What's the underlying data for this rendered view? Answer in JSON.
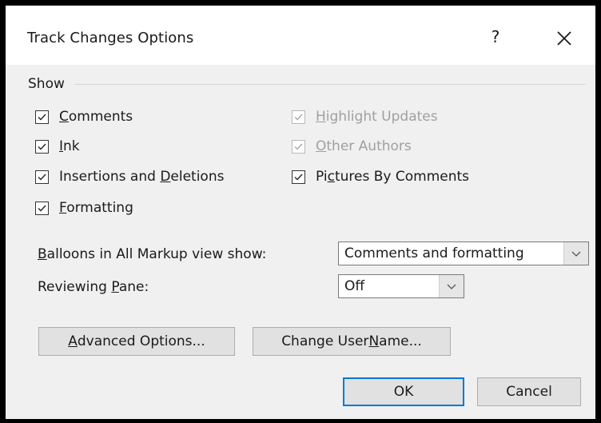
{
  "dialog": {
    "title": "Track Changes Options",
    "help_label": "?",
    "close_icon": "close-icon"
  },
  "show_group": {
    "label": "Show",
    "checkboxes": [
      {
        "pre": "",
        "key": "C",
        "post": "omments",
        "checked": true,
        "enabled": true
      },
      {
        "pre": "",
        "key": "I",
        "post": "nk",
        "checked": true,
        "enabled": true
      },
      {
        "pre": "Insertions and ",
        "key": "D",
        "post": "eletions",
        "checked": true,
        "enabled": true
      },
      {
        "pre": "",
        "key": "F",
        "post": "ormatting",
        "checked": true,
        "enabled": true
      },
      {
        "pre": "",
        "key": "H",
        "post": "ighlight Updates",
        "checked": true,
        "enabled": false
      },
      {
        "pre": "",
        "key": "O",
        "post": "ther Authors",
        "checked": true,
        "enabled": false
      },
      {
        "pre": "Pi",
        "key": "c",
        "post": "tures By Comments",
        "checked": true,
        "enabled": true
      }
    ]
  },
  "balloons": {
    "pre": "",
    "key": "B",
    "post": "alloons in All Markup view show:",
    "value": "Comments and formatting"
  },
  "reviewing_pane": {
    "pre": "Reviewing ",
    "key": "P",
    "post": "ane:",
    "value": "Off"
  },
  "buttons": {
    "advanced": {
      "pre": "",
      "key": "A",
      "post": "dvanced Options..."
    },
    "change_user": {
      "pre": "Change User ",
      "key": "N",
      "post": "ame..."
    },
    "ok": "OK",
    "cancel": "Cancel"
  },
  "colors": {
    "accent": "#0078d7",
    "dialog_bg": "#f0f0f0",
    "disabled_text": "#a0a0a0"
  }
}
